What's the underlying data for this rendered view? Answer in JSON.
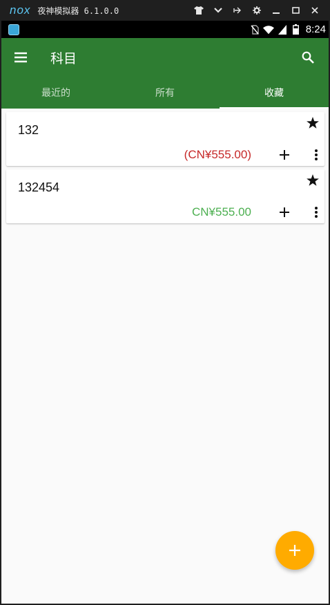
{
  "emulator": {
    "logo": "nox",
    "title": "夜神模拟器 6.1.0.0",
    "controls": [
      "shirt-icon",
      "chevron-down-icon",
      "pin-icon",
      "gear-icon",
      "minimize-icon",
      "maximize-icon",
      "close-icon"
    ]
  },
  "statusbar": {
    "time": "8:24",
    "icons": [
      "app-icon",
      "no-sim-icon",
      "wifi-icon",
      "signal-icon",
      "battery-icon"
    ]
  },
  "appbar": {
    "title": "科目",
    "menu_icon": "hamburger-menu-icon",
    "search_icon": "search-icon",
    "background": "#2e7d32"
  },
  "tabs": [
    {
      "label": "最近的",
      "active": false
    },
    {
      "label": "所有",
      "active": false
    },
    {
      "label": "收藏",
      "active": true
    }
  ],
  "accounts": [
    {
      "name": "132",
      "amount": "(CN¥555.00)",
      "amount_color": "#c62828",
      "favorite": true
    },
    {
      "name": "132454",
      "amount": "CN¥555.00",
      "amount_color": "#4caf50",
      "favorite": true
    }
  ],
  "fab": {
    "icon": "plus-icon",
    "color": "#ffab00"
  }
}
